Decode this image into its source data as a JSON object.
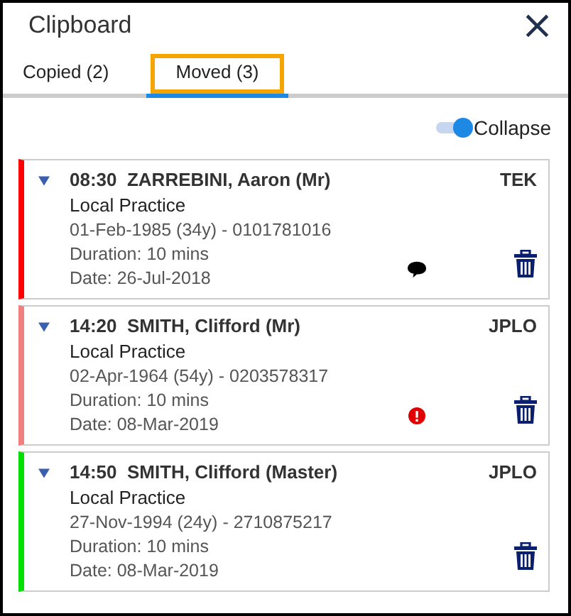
{
  "window": {
    "title": "Clipboard",
    "close": "×"
  },
  "tabs": [
    {
      "label": "Copied (2)",
      "selected": false,
      "highlighted": false
    },
    {
      "label": "Moved (3)",
      "selected": true,
      "highlighted": true
    }
  ],
  "collapse": {
    "label": "Collapse",
    "on": true
  },
  "appointments": [
    {
      "time": "08:30",
      "name": "ZARREBINI, Aaron (Mr)",
      "user": "TEK",
      "practice": "Local Practice",
      "details": "01-Feb-1985 (34y) - 0101781016",
      "duration": "Duration: 10 mins",
      "date": "Date: 26-Jul-2018",
      "color": "#ff0000",
      "kind": "comment"
    },
    {
      "time": "14:20",
      "name": "SMITH, Clifford (Mr)",
      "user": "JPLO",
      "practice": "Local Practice",
      "details": "02-Apr-1964 (54y) - 0203578317",
      "duration": "Duration: 10 mins",
      "date": "Date: 08-Mar-2019",
      "color": "#f08080",
      "kind": "alert"
    },
    {
      "time": "14:50",
      "name": "SMITH, Clifford (Master)",
      "user": "JPLO",
      "practice": "Local Practice",
      "details": "27-Nov-1994 (24y) - 2710875217",
      "duration": "Duration: 10 mins",
      "date": "Date: 08-Mar-2019",
      "color": "#00e000",
      "kind": "plain"
    }
  ]
}
